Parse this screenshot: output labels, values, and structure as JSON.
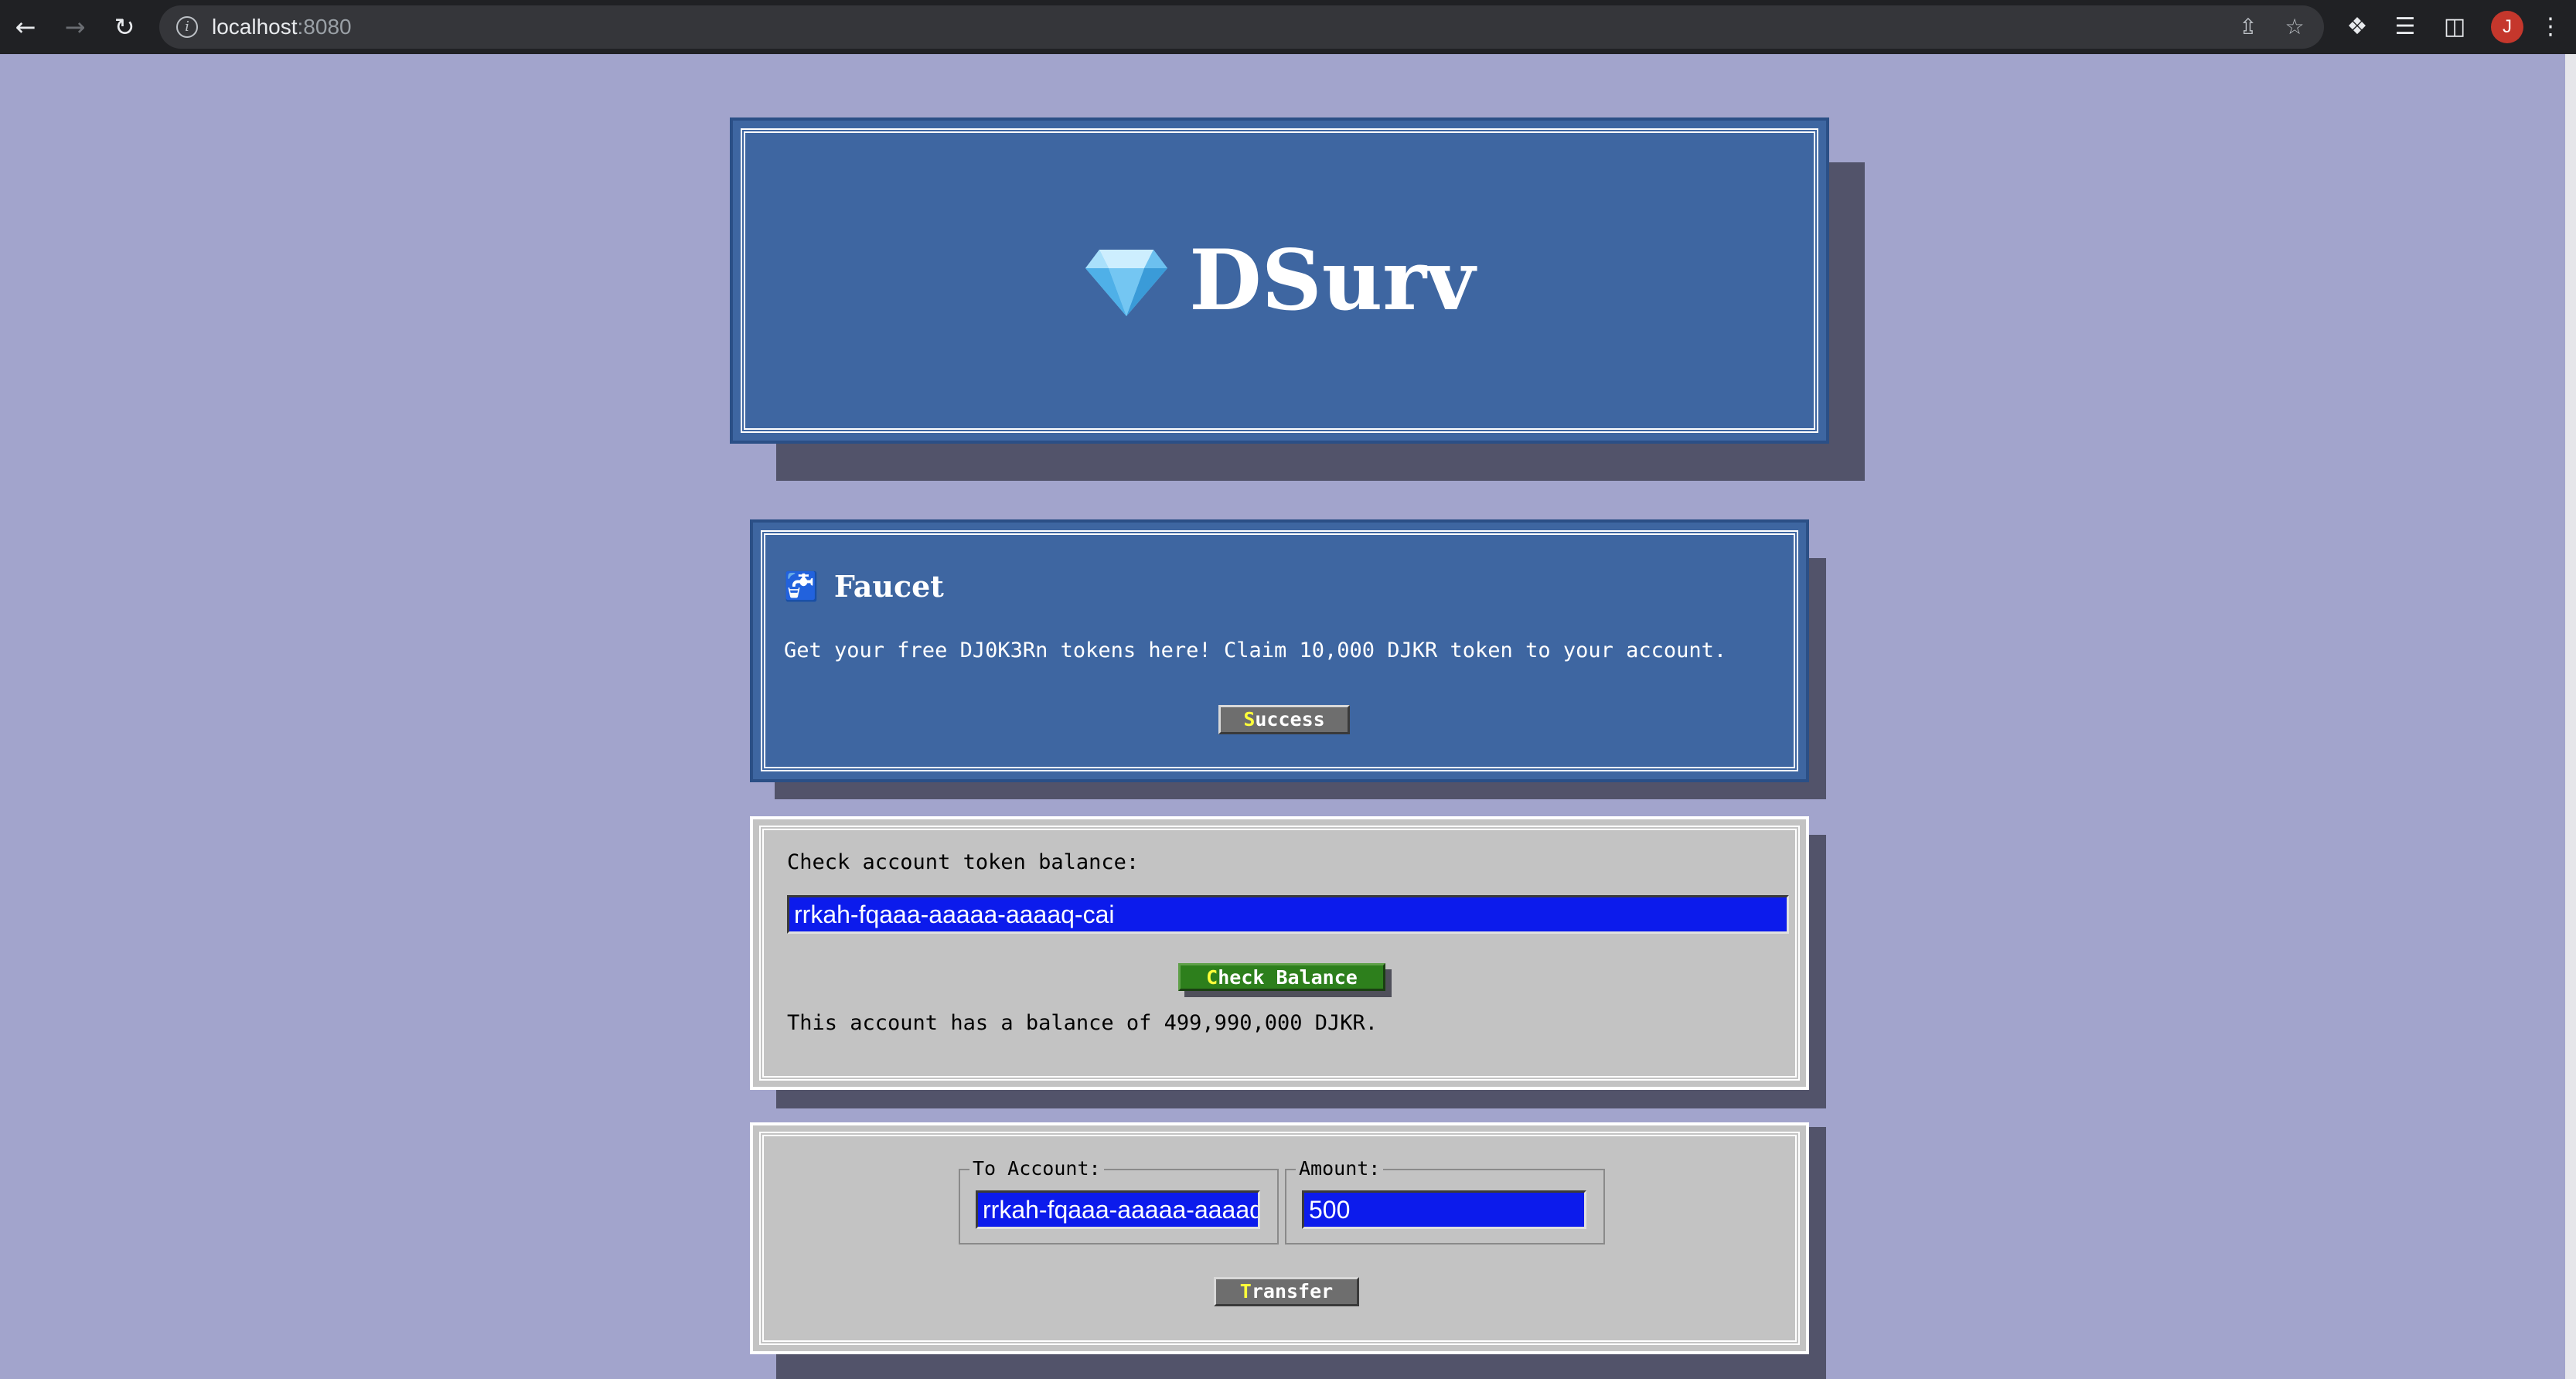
{
  "browser": {
    "url_host": "localhost",
    "url_port": ":8080",
    "profile_initial": "J"
  },
  "header": {
    "logo_icon": "gem-icon",
    "title": "DSurv"
  },
  "faucet": {
    "icon": "faucet-icon",
    "title": "Faucet",
    "description": "Get your free DJ0K3Rn tokens here! Claim 10,000 DJKR token to your account.",
    "button_hotkey": "S",
    "button_rest": "uccess"
  },
  "balance": {
    "label": "Check account token balance:",
    "account_value": "rrkah-fqaaa-aaaaa-aaaaq-cai",
    "button_hotkey": "C",
    "button_rest": "heck Balance",
    "result": "This account has a balance of 499,990,000 DJKR."
  },
  "transfer": {
    "to_label": "To Account:",
    "to_value": "rrkah-fqaaa-aaaaa-aaaaq-cai",
    "amount_label": "Amount:",
    "amount_value": "500",
    "button_hotkey": "T",
    "button_rest": "ransfer"
  },
  "colors": {
    "page_bg": "#a2a4cc",
    "panel_blue": "#3e66a1",
    "panel_gray": "#c3c3c3",
    "input_blue": "#0c1bec",
    "button_green": "#2d7f1c",
    "hotkey_yellow": "#ffff3a"
  }
}
